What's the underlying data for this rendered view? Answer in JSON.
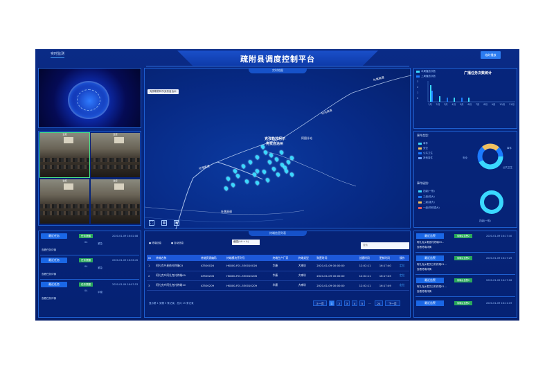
{
  "header": {
    "tab_live": "实时监测",
    "title": "疏附县调度控制平台",
    "broadcast_button": "临时播放"
  },
  "video": {
    "thumb_caption": "监控"
  },
  "map": {
    "title": "实时地图",
    "tooltip": "克孜勒苏柯尔克孜自治州",
    "labels": {
      "city_line1": "克孜勒苏柯尔",
      "city_line2": "克孜自治州",
      "place": "阿图什站",
      "road1": "吐乌高速",
      "road2": "吐喀高速",
      "road3": "吐喀高速",
      "road4": "吐喀高速"
    }
  },
  "stats": {
    "title": "广播任务次数统计",
    "legend": [
      "本周播放次数",
      "上周播放次数"
    ],
    "months": [
      "1月",
      "2月",
      "3月",
      "4月",
      "5月",
      "6月",
      "7月",
      "8月",
      "9月",
      "10月",
      "11月"
    ],
    "yticks": [
      "3",
      "2",
      "1",
      "0"
    ]
  },
  "events": {
    "type_title": "事件类型:",
    "type_items": [
      "事件",
      "安全",
      "公共卫生",
      "其他事件"
    ],
    "donut_labels": [
      "事件",
      "公共卫生",
      "安全"
    ],
    "level_title": "事件级别:",
    "level_items": [
      "四级(一般)",
      "三级(较大)",
      "二级(重大)",
      "一级(特别重大)"
    ],
    "level_ring_label": "四级(一般)"
  },
  "tasks": {
    "items": [
      {
        "button": "最近任务",
        "tag": "任务提醒",
        "time": "2020-01-09 16:02:08",
        "count": "04",
        "flag": "紧急",
        "link": "查看任务详情"
      },
      {
        "button": "最近任务",
        "tag": "任务提醒",
        "time": "2020-01-09 16:56:45",
        "count": "04",
        "flag": "紧急",
        "link": "查看任务详情"
      },
      {
        "button": "最近任务",
        "tag": "任务提醒",
        "time": "2020-01-09 16:07:53",
        "count": "04",
        "flag": "平稳",
        "link": "查看任务详情"
      }
    ]
  },
  "terminals": {
    "title": "终端信息列表",
    "radio_terminal": "终端信息",
    "radio_self": "自动信息",
    "filter_placeholder": "截图(Alt + A)",
    "search_placeholder": "搜索",
    "columns": [
      "ID",
      "终端名称",
      "终端资源编码",
      "终端模块序列号",
      "终端生产厂家",
      "终端类型",
      "购置时间",
      "创建时间",
      "更新时间",
      "操作"
    ],
    "rows": [
      [
        "1",
        "阿扎克乡麦依村终端03",
        "AT500026",
        "HK800-F01-530010026",
        "华康",
        "大喇叭",
        "2020-01-09 00:00:00",
        "12:02:11",
        "16:17:40",
        "定位"
      ],
      [
        "2",
        "阿扎克乡阿扎克村终端09",
        "AT500206",
        "HK800-F01-530010206",
        "华康",
        "大喇叭",
        "2020-01-09 00:00:00",
        "12:02:11",
        "16:17:45",
        "定位"
      ],
      [
        "3",
        "阿扎克乡阿扎克村终端10",
        "AT500209",
        "HK800-F01-530010209",
        "华康",
        "大喇叭",
        "2020-01-09 00:00:00",
        "12:02:11",
        "16:17:49",
        "定位"
      ]
    ],
    "footer": "显示第 1 到第 3 条记录，总共 15 条记录",
    "pager": [
      "上一页",
      "1",
      "2",
      "3",
      "4",
      "5",
      "...",
      "24",
      "下一页"
    ]
  },
  "alerts": {
    "items": [
      {
        "button": "最近告警",
        "tag": "待确认告警2",
        "time": "2020-01-09 16:17:40",
        "text": "阿扎克乡麦依村终端03...",
        "link": "查看终端详情"
      },
      {
        "button": "最近告警",
        "tag": "待确认告警2",
        "time": "2020-01-09 16:17:29",
        "text": "阿扎克乡麦艾日村终端01...",
        "link": "查看终端详情"
      },
      {
        "button": "最近告警",
        "tag": "待确认告警2",
        "time": "2020-01-09 16:17:26",
        "text": "阿扎克乡麦艾日村终端01...",
        "link": "查看终端详情"
      },
      {
        "button": "最近告警",
        "tag": "待确认告警2",
        "time": "2020-01-09 16:11:19",
        "text": "",
        "link": ""
      }
    ]
  },
  "colors": {
    "accent": "#2c7cf0",
    "bg": "#072477",
    "green": "#2aa85c",
    "cyan": "#3ad8ff"
  }
}
